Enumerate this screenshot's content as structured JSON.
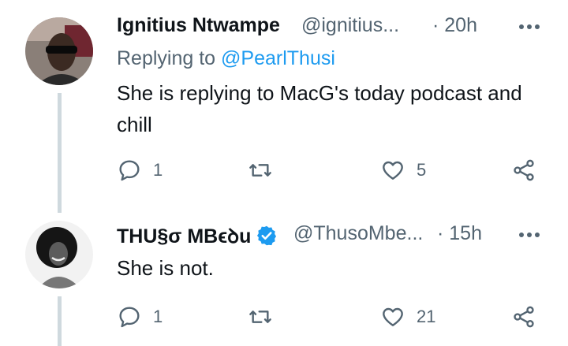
{
  "tweets": [
    {
      "author_name": "Ignitius Ntwampe",
      "handle": "@ignitius...",
      "time": "· 20h",
      "replying_label": "Replying to",
      "replying_to": "@PearlThusi",
      "text": "She is replying to MacG's today podcast and chill",
      "replies": "1",
      "retweets": "",
      "likes": "5"
    },
    {
      "author_name": "THU§σ MBϵꝺu",
      "handle": "@ThusoMbe...",
      "time": "· 15h",
      "verified": true,
      "text": "She is not.",
      "replies": "1",
      "retweets": "",
      "likes": "21"
    }
  ],
  "icons": {
    "more": "more-icon",
    "reply": "reply-icon",
    "retweet": "retweet-icon",
    "like": "heart-icon",
    "share": "share-icon",
    "verified": "verified-badge-icon"
  },
  "colors": {
    "text_primary": "#0f1419",
    "text_secondary": "#536471",
    "accent": "#1d9bf0",
    "thread_line": "#cfd9de"
  }
}
